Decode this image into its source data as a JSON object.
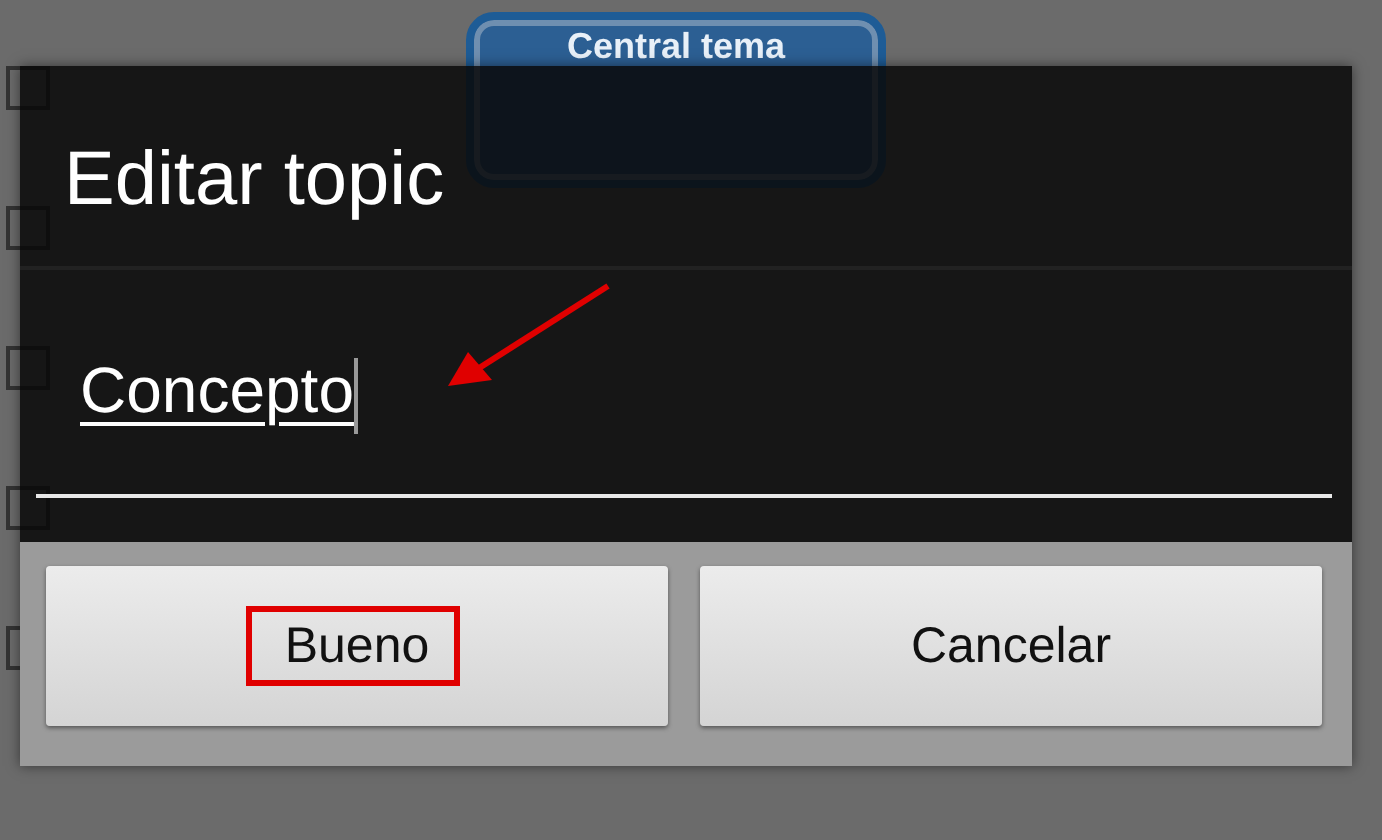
{
  "background": {
    "node": {
      "label": "Central tema"
    }
  },
  "dialog": {
    "title": "Editar topic",
    "field": {
      "value": "Concepto",
      "focused": true
    },
    "buttons": [
      {
        "label": "Bueno",
        "highlighted": true
      },
      {
        "label": "Cancelar",
        "highlighted": false
      }
    ]
  },
  "annotations": [
    {
      "kind": "arrow"
    }
  ]
}
